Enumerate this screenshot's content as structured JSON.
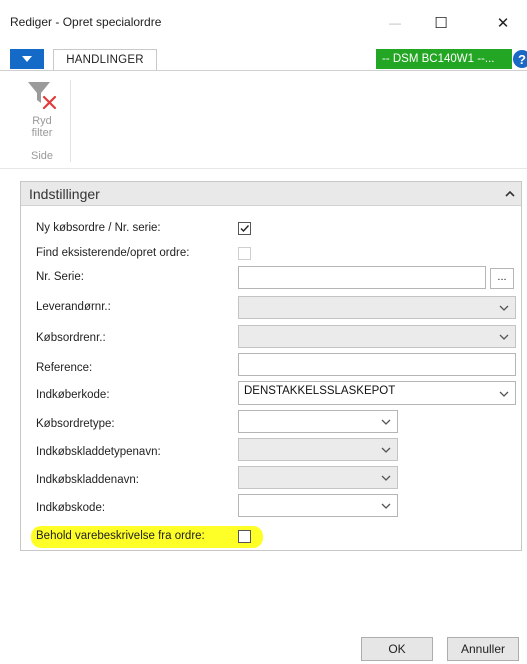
{
  "window": {
    "title": "Rediger - Opret specialordre",
    "minimize_label": "—",
    "maximize_label": "☐",
    "close_label": "✕"
  },
  "ribbon": {
    "tab": "HANDLINGER",
    "company": "-- DSM BC140W1 --...",
    "help": "?",
    "action": {
      "label_line1": "Ryd",
      "label_line2": "filter",
      "icon": "clear-filter-icon"
    },
    "group_label": "Side"
  },
  "panel": {
    "title": "Indstillinger",
    "fields": {
      "ny_kobsordre": {
        "label": "Ny købsordre / Nr. serie:",
        "checked": true
      },
      "find_eksisterende": {
        "label": "Find eksisterende/opret ordre:",
        "checked": false
      },
      "nr_serie": {
        "label": "Nr. Serie:",
        "value": "",
        "lookup": "..."
      },
      "leverandornr": {
        "label": "Leverandørnr.:",
        "value": ""
      },
      "kobsordrenr": {
        "label": "Købsordrenr.:",
        "value": ""
      },
      "reference": {
        "label": "Reference:",
        "value": ""
      },
      "indkoberkode": {
        "label": "Indkøberkode:",
        "value": "DENSTAKKELSSLASKEPOT"
      },
      "kobsordretype": {
        "label": "Købsordretype:",
        "value": ""
      },
      "indkobskladdetypenavn": {
        "label": "Indkøbskladdetypenavn:",
        "value": ""
      },
      "indkobskladdenavn": {
        "label": "Indkøbskladdenavn:",
        "value": ""
      },
      "indkobskode": {
        "label": "Indkøbskode:",
        "value": ""
      },
      "behold_varebeskrivelse": {
        "label": "Behold varebeskrivelse fra ordre:",
        "checked": false,
        "highlight_color": "#ffff28"
      }
    }
  },
  "footer": {
    "ok": "OK",
    "cancel": "Annuller"
  },
  "colors": {
    "accent": "#1569c7",
    "company_badge": "#23a623",
    "help_icon": "#1a68c5"
  }
}
